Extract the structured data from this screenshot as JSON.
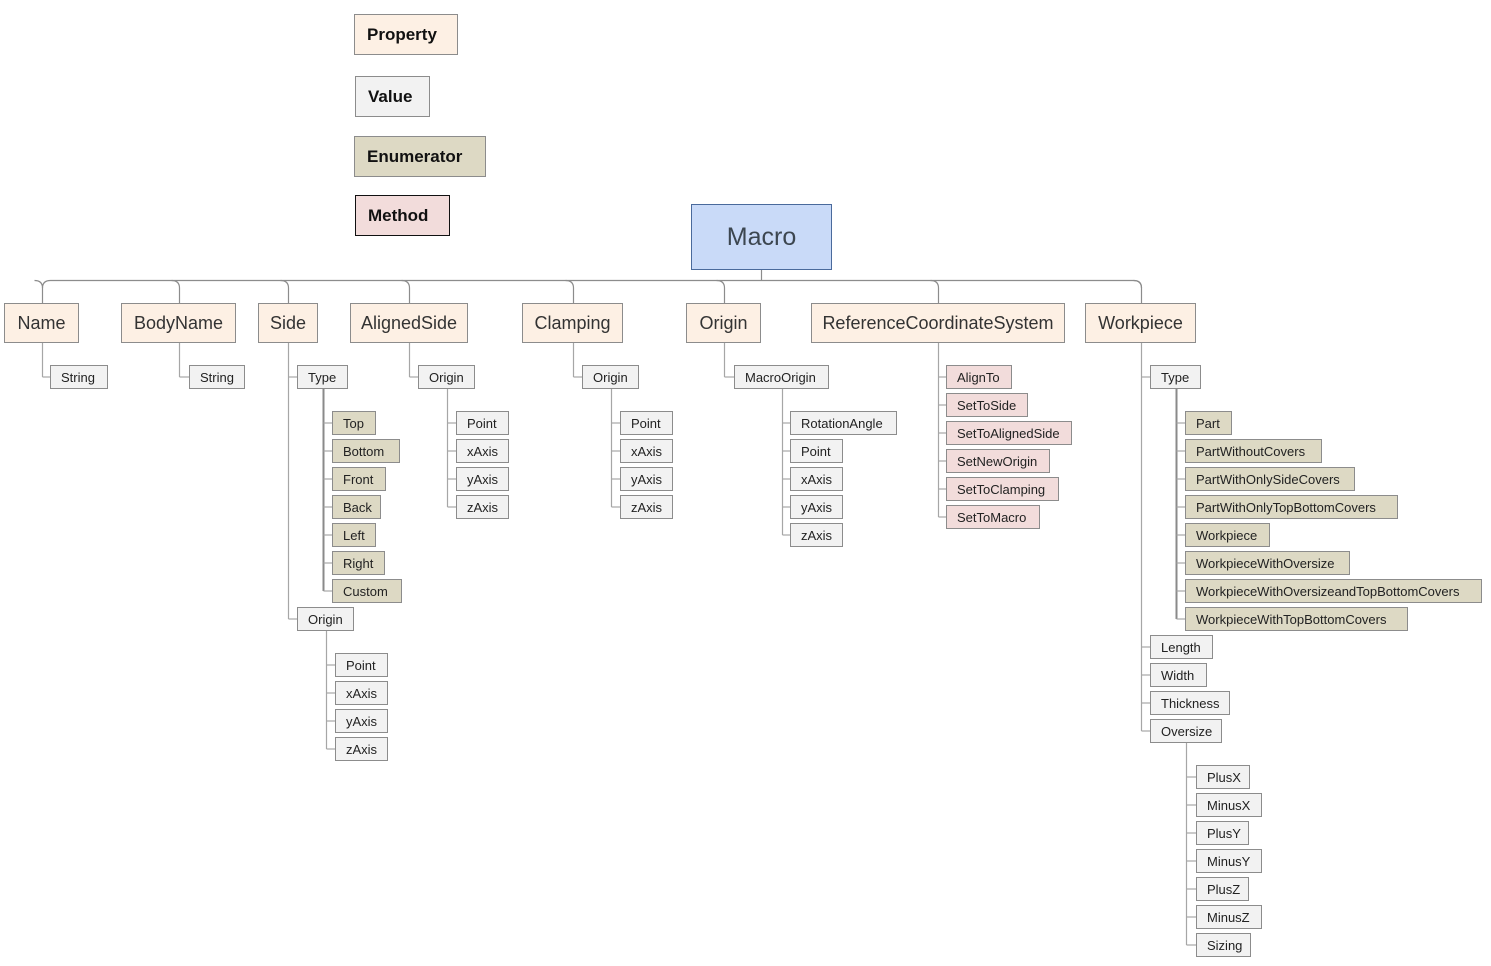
{
  "legend": [
    {
      "label": "Property",
      "type": "P"
    },
    {
      "label": "Value",
      "type": "V"
    },
    {
      "label": "Enumerator",
      "type": "E"
    },
    {
      "label": "Method",
      "type": "M"
    }
  ],
  "colors": {
    "property": "#fdf0e4",
    "value": "#f2f2f2",
    "enumerator": "#ddd9c4",
    "method": "#f2dcdb",
    "root": "#c9daf8"
  },
  "root": {
    "label": "Macro"
  },
  "nodes": [
    {
      "label": "Name",
      "type": "P",
      "children": [
        {
          "label": "String",
          "type": "V"
        }
      ]
    },
    {
      "label": "BodyName",
      "type": "P",
      "children": [
        {
          "label": "String",
          "type": "V"
        }
      ]
    },
    {
      "label": "Side",
      "type": "P",
      "children": [
        {
          "label": "Type",
          "type": "V",
          "children": [
            {
              "label": "Top",
              "type": "E"
            },
            {
              "label": "Bottom",
              "type": "E"
            },
            {
              "label": "Front",
              "type": "E"
            },
            {
              "label": "Back",
              "type": "E"
            },
            {
              "label": "Left",
              "type": "E"
            },
            {
              "label": "Right",
              "type": "E"
            },
            {
              "label": "Custom",
              "type": "E"
            }
          ]
        },
        {
          "label": "Origin",
          "type": "V",
          "children": [
            {
              "label": "Point",
              "type": "V"
            },
            {
              "label": "xAxis",
              "type": "V"
            },
            {
              "label": "yAxis",
              "type": "V"
            },
            {
              "label": "zAxis",
              "type": "V"
            }
          ]
        }
      ]
    },
    {
      "label": "AlignedSide",
      "type": "P",
      "children": [
        {
          "label": "Origin",
          "type": "V",
          "children": [
            {
              "label": "Point",
              "type": "V"
            },
            {
              "label": "xAxis",
              "type": "V"
            },
            {
              "label": "yAxis",
              "type": "V"
            },
            {
              "label": "zAxis",
              "type": "V"
            }
          ]
        }
      ]
    },
    {
      "label": "Clamping",
      "type": "P",
      "children": [
        {
          "label": "Origin",
          "type": "V",
          "children": [
            {
              "label": "Point",
              "type": "V"
            },
            {
              "label": "xAxis",
              "type": "V"
            },
            {
              "label": "yAxis",
              "type": "V"
            },
            {
              "label": "zAxis",
              "type": "V"
            }
          ]
        }
      ]
    },
    {
      "label": "Origin",
      "type": "P",
      "children": [
        {
          "label": "MacroOrigin",
          "type": "V",
          "children": [
            {
              "label": "RotationAngle",
              "type": "V"
            },
            {
              "label": "Point",
              "type": "V"
            },
            {
              "label": "xAxis",
              "type": "V"
            },
            {
              "label": "yAxis",
              "type": "V"
            },
            {
              "label": "zAxis",
              "type": "V"
            }
          ]
        }
      ]
    },
    {
      "label": "ReferenceCoordinateSystem",
      "type": "P",
      "children": [
        {
          "label": "AlignTo",
          "type": "M"
        },
        {
          "label": "SetToSide",
          "type": "M"
        },
        {
          "label": "SetToAlignedSide",
          "type": "M"
        },
        {
          "label": "SetNewOrigin",
          "type": "M"
        },
        {
          "label": "SetToClamping",
          "type": "M"
        },
        {
          "label": "SetToMacro",
          "type": "M"
        }
      ]
    },
    {
      "label": "Workpiece",
      "type": "P",
      "children": [
        {
          "label": "Type",
          "type": "V",
          "children": [
            {
              "label": "Part",
              "type": "E"
            },
            {
              "label": "PartWithoutCovers",
              "type": "E"
            },
            {
              "label": "PartWithOnlySideCovers",
              "type": "E"
            },
            {
              "label": "PartWithOnlyTopBottomCovers",
              "type": "E"
            },
            {
              "label": "Workpiece",
              "type": "E"
            },
            {
              "label": "WorkpieceWithOversize",
              "type": "E"
            },
            {
              "label": "WorkpieceWithOversizeandTopBottomCovers",
              "type": "E"
            },
            {
              "label": "WorkpieceWithTopBottomCovers",
              "type": "E"
            }
          ]
        },
        {
          "label": "Length",
          "type": "V"
        },
        {
          "label": "Width",
          "type": "V"
        },
        {
          "label": "Thickness",
          "type": "V"
        },
        {
          "label": "Oversize",
          "type": "V",
          "children": [
            {
              "label": "PlusX",
              "type": "V"
            },
            {
              "label": "MinusX",
              "type": "V"
            },
            {
              "label": "PlusY",
              "type": "V"
            },
            {
              "label": "MinusY",
              "type": "V"
            },
            {
              "label": "PlusZ",
              "type": "V"
            },
            {
              "label": "MinusZ",
              "type": "V"
            },
            {
              "label": "Sizing",
              "type": "V"
            }
          ]
        }
      ]
    }
  ]
}
